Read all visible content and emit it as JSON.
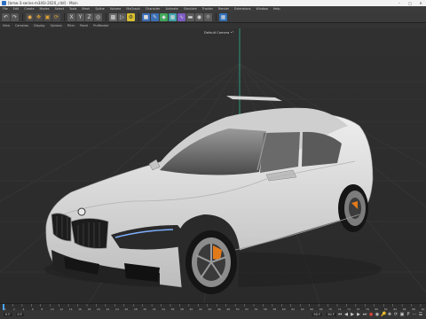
{
  "window": {
    "title": "[bmw-3-series-m340i-2020_c4d] - Main"
  },
  "menubar": {
    "items": [
      "File",
      "Edit",
      "Create",
      "Modes",
      "Select",
      "Tools",
      "Mesh",
      "Spline",
      "Volume",
      "MoGraph",
      "Character",
      "Animate",
      "Simulate",
      "Tracker",
      "Render",
      "Extensions",
      "Window",
      "Help"
    ]
  },
  "viewport_menu": {
    "items": [
      "View",
      "Cameras",
      "Display",
      "Options",
      "Filter",
      "Panel",
      "ProRender"
    ]
  },
  "viewport": {
    "camera_label": "Default Camera •°"
  },
  "timeline": {
    "ticks": [
      "0",
      "2",
      "4",
      "6",
      "8",
      "10",
      "12",
      "14",
      "16",
      "18",
      "20",
      "22",
      "24",
      "26",
      "28",
      "30",
      "32",
      "34",
      "36",
      "38",
      "40",
      "42",
      "44",
      "46",
      "48",
      "50",
      "52",
      "54",
      "56",
      "58",
      "60",
      "62",
      "64",
      "66",
      "68",
      "70",
      "72",
      "74",
      "76",
      "78",
      "80",
      "82",
      "84",
      "86",
      "88",
      "90"
    ],
    "end_label": "0 F"
  },
  "statusbar": {
    "current_frame": "0 F",
    "start_frame": "0 F",
    "end_frame": "90 F",
    "max_frame": "90 F"
  },
  "colors": {
    "viewport_bg": "#2d2d2d",
    "car_body": "#dcdcdc",
    "axis_green": "#2fb58f",
    "accent": "#f3f3f3"
  },
  "icons": {
    "toolbar": [
      "undo-icon",
      "redo-icon",
      "live-selection-icon",
      "move-icon",
      "scale-icon",
      "rotate-icon",
      "x-axis-icon",
      "y-axis-icon",
      "z-axis-icon",
      "coordinate-system-icon",
      "render-view-icon",
      "render-picture-viewer-icon",
      "render-settings-icon",
      "cube-icon",
      "pen-icon",
      "subdivision-icon",
      "cloner-icon",
      "deformer-icon",
      "floor-icon",
      "camera-icon",
      "light-icon",
      "layout-icon"
    ]
  }
}
